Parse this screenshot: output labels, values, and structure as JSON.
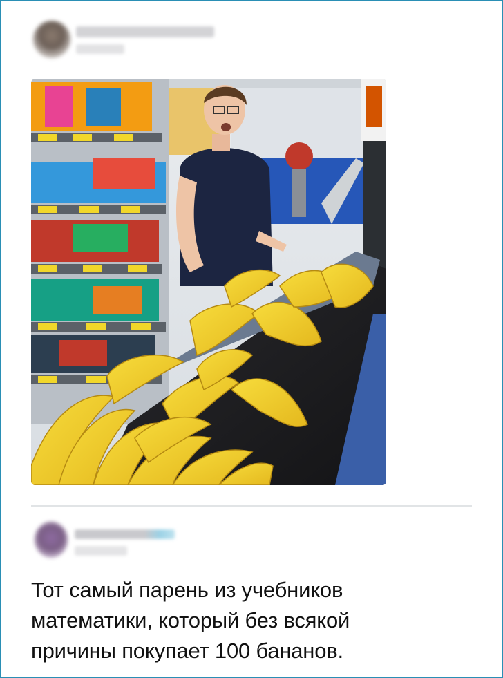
{
  "post": {
    "image_alt": "Парень на кассе с горой бананов на ленте"
  },
  "reply": {
    "text_lines": [
      "Тот самый парень из учебников",
      "математики, который без всякой",
      "причины покупает 100 бананов."
    ]
  },
  "colors": {
    "frame_border": "#2a8fb5",
    "divider": "#e1e4e6",
    "text": "#111111"
  }
}
